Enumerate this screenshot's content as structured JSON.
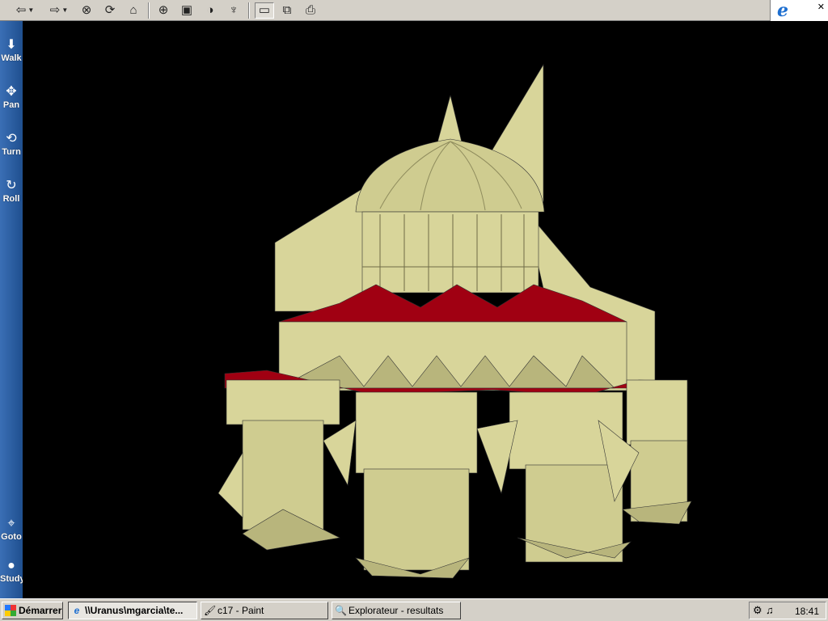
{
  "toolbar": {
    "buttons": [
      {
        "name": "back-icon",
        "glyph": "⇦"
      },
      {
        "name": "forward-icon",
        "glyph": "⇨"
      },
      {
        "name": "stop-icon",
        "glyph": "⊗"
      },
      {
        "name": "refresh-icon",
        "glyph": "⟳"
      },
      {
        "name": "home-icon",
        "glyph": "⌂"
      },
      {
        "name": "zoom-icon",
        "glyph": "⊕"
      },
      {
        "name": "viewpoint-icon",
        "glyph": "▣"
      },
      {
        "name": "compass-icon",
        "glyph": "◑"
      },
      {
        "name": "antenna-icon",
        "glyph": "♆"
      },
      {
        "name": "window-icon",
        "glyph": "▭"
      },
      {
        "name": "copy-window-icon",
        "glyph": "⧉"
      },
      {
        "name": "print-icon",
        "glyph": "⎙"
      }
    ],
    "ie_logo": "e",
    "close_glyph": "✕"
  },
  "nav": {
    "walk": "Walk",
    "pan": "Pan",
    "turn": "Turn",
    "roll": "Roll",
    "goto": "Goto",
    "study": "Study"
  },
  "taskbar": {
    "start": "Démarrer",
    "tasks": [
      {
        "label": "\\\\Uranus\\mgarcia\\te...",
        "icon": "ie-icon",
        "active": true
      },
      {
        "label": "c17 - Paint",
        "icon": "paint-icon",
        "active": false
      },
      {
        "label": "Explorateur - resultats",
        "icon": "explorer-icon",
        "active": false
      }
    ],
    "clock": "18:41"
  },
  "colors": {
    "model_body": "#d8d59a",
    "model_shade": "#b8b57c",
    "roof_red": "#a00012",
    "background": "#000000",
    "nav_blue": "#2a5ea3"
  }
}
